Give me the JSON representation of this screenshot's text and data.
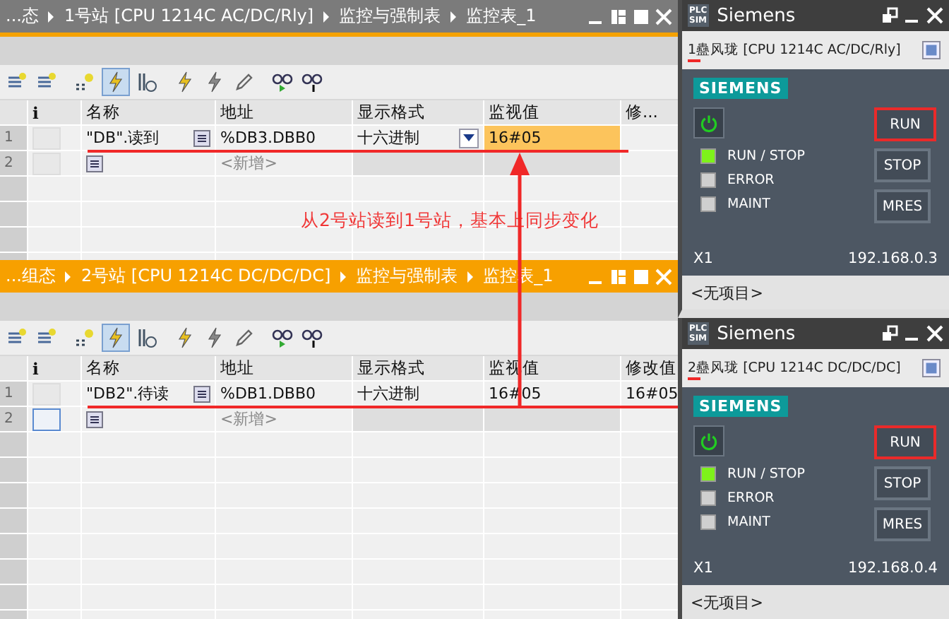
{
  "windows": [
    {
      "active": false,
      "breadcrumb": [
        "...态",
        "1号站 [CPU 1214C AC/DC/Rly]",
        "监控与强制表",
        "监控表_1"
      ],
      "columns": [
        "i",
        "名称",
        "地址",
        "显示格式",
        "监视值",
        "修..."
      ],
      "rows": [
        {
          "number": "1",
          "name": "\"DB\".读到",
          "address": "%DB3.DBB0",
          "format": "十六进制",
          "monitor": "16#05",
          "modify": "",
          "highlighted": true,
          "underlined": true,
          "dropdown": true,
          "selected": false
        },
        {
          "number": "2",
          "name": "",
          "address": "<新增>",
          "format": "",
          "monitor": "",
          "modify": "",
          "highlighted": false,
          "underlined": false,
          "dropdown": false,
          "selected": false
        }
      ]
    },
    {
      "active": true,
      "breadcrumb": [
        "...组态",
        "2号站 [CPU 1214C DC/DC/DC]",
        "监控与强制表",
        "监控表_1"
      ],
      "columns": [
        "i",
        "名称",
        "地址",
        "显示格式",
        "监视值",
        "修改值"
      ],
      "rows": [
        {
          "number": "1",
          "name": "\"DB2\".待读",
          "address": "%DB1.DBB0",
          "format": "十六进制",
          "monitor": "16#05",
          "modify": "16#05",
          "highlighted": false,
          "underlined": true,
          "dropdown": false,
          "selected": false
        },
        {
          "number": "2",
          "name": "",
          "address": "<新增>",
          "format": "",
          "monitor": "",
          "modify": "",
          "highlighted": false,
          "underlined": false,
          "dropdown": false,
          "selected": true
        }
      ]
    }
  ],
  "panels": [
    {
      "logo_top": "PLC",
      "logo_bottom": "SIM",
      "title": "Siemens",
      "device": "1蠱风珑 [CPU 1214C AC/DC/Rly]",
      "brand": "SIEMENS",
      "leds": [
        {
          "label": "RUN / STOP",
          "on": true
        },
        {
          "label": "ERROR",
          "on": false
        },
        {
          "label": "MAINT",
          "on": false
        }
      ],
      "buttons": [
        {
          "label": "RUN",
          "highlighted": true
        },
        {
          "label": "STOP",
          "highlighted": false
        },
        {
          "label": "MRES",
          "highlighted": false
        }
      ],
      "port": "X1",
      "ip": "192.168.0.3",
      "footer": "<无项目>"
    },
    {
      "logo_top": "PLC",
      "logo_bottom": "SIM",
      "title": "Siemens",
      "device": "2蠱风珑 [CPU 1214C DC/DC/DC]",
      "brand": "SIEMENS",
      "leds": [
        {
          "label": "RUN / STOP",
          "on": true
        },
        {
          "label": "ERROR",
          "on": false
        },
        {
          "label": "MAINT",
          "on": false
        }
      ],
      "buttons": [
        {
          "label": "RUN",
          "highlighted": true
        },
        {
          "label": "STOP",
          "highlighted": false
        },
        {
          "label": "MRES",
          "highlighted": false
        }
      ],
      "port": "X1",
      "ip": "192.168.0.4",
      "footer": "<无项目>"
    }
  ],
  "annotation": "从2号站读到1号站，基本上同步变化"
}
